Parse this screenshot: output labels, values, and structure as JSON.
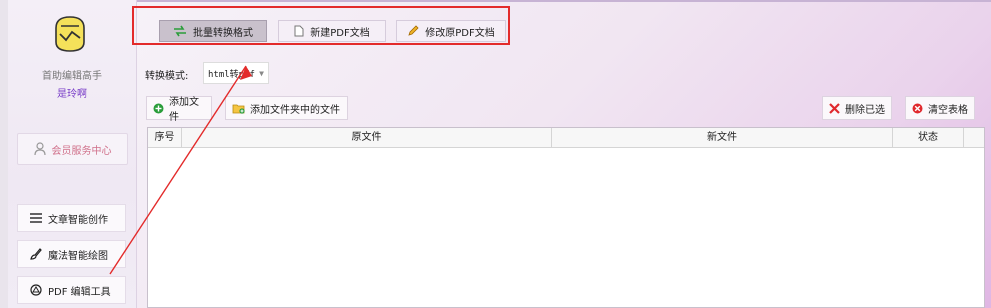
{
  "sidebar": {
    "user_name": "首助编辑高手",
    "user_sub": "是玲啊",
    "vip_label": "会员服务中心",
    "items": [
      {
        "label": "文章智能创作"
      },
      {
        "label": "魔法智能绘图"
      },
      {
        "label": "PDF 编辑工具"
      }
    ]
  },
  "tabs": [
    {
      "label": "批量转换格式",
      "active": true
    },
    {
      "label": "新建PDF文档",
      "active": false
    },
    {
      "label": "修改原PDF文档",
      "active": false
    }
  ],
  "mode": {
    "label": "转换模式:",
    "value": "html转pdf"
  },
  "toolbar": {
    "add_file": "添加文件",
    "add_folder": "添加文件夹中的文件",
    "delete_selected": "删除已选",
    "clear_table": "清空表格"
  },
  "table": {
    "columns": [
      "序号",
      "原文件",
      "新文件",
      "状态"
    ],
    "rows": []
  },
  "colors": {
    "accent_red": "#e32b2b",
    "vip_pink": "#d0708a",
    "user_purple": "#7a3fc8"
  }
}
